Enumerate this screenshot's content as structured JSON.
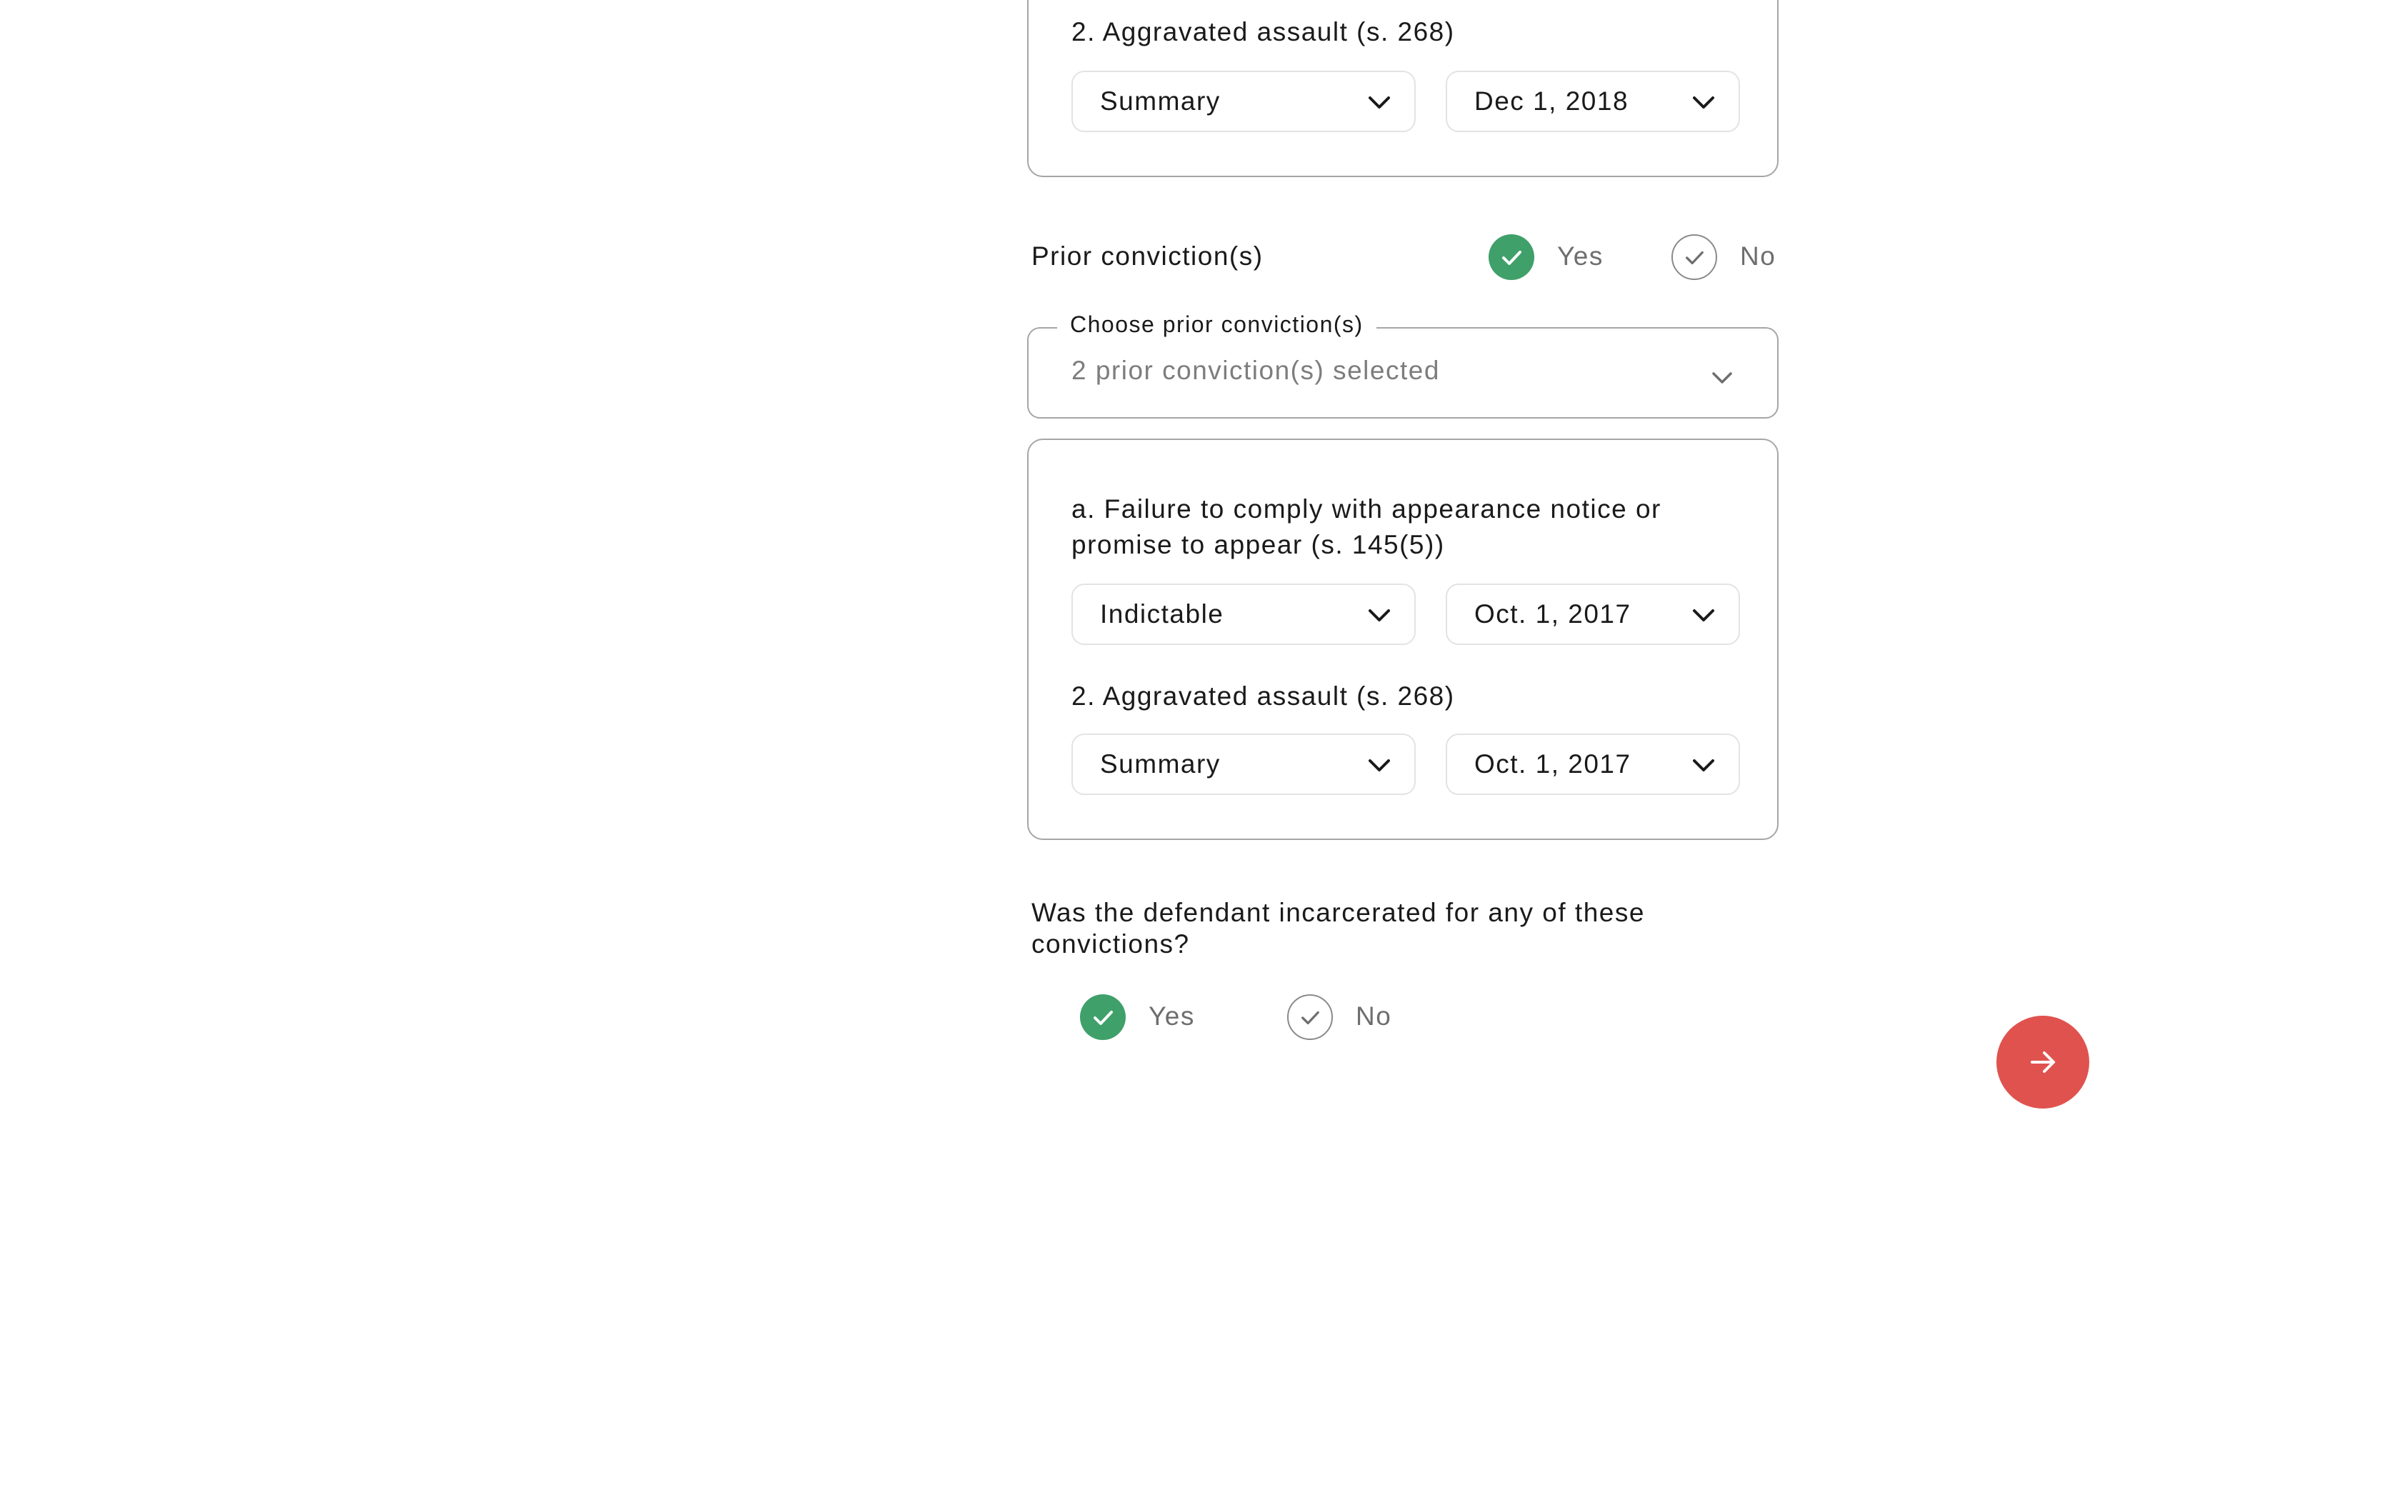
{
  "current_offence_card": {
    "offence_label": "2. Aggravated assault (s. 268)",
    "type_select": "Summary",
    "date_select": "Dec 1, 2018"
  },
  "prior_convictions": {
    "question": "Prior conviction(s)",
    "yes_label": "Yes",
    "no_label": "No",
    "selected": "Yes"
  },
  "prior_dropdown": {
    "legend": "Choose prior conviction(s)",
    "value": "2 prior conviction(s) selected"
  },
  "prior_list": [
    {
      "label": "a.  Failure to comply with appearance notice or promise to appear (s. 145(5))",
      "type_select": "Indictable",
      "date_select": "Oct. 1, 2017"
    },
    {
      "label": "2. Aggravated assault (s. 268)",
      "type_select": "Summary",
      "date_select": "Oct. 1, 2017"
    }
  ],
  "incarceration": {
    "question": "Was the defendant incarcerated for any of these convictions?",
    "yes_label": "Yes",
    "no_label": "No",
    "selected": "Yes"
  },
  "next_button": {
    "icon": "arrow-right-icon"
  },
  "colors": {
    "accent_green": "#3fa06a",
    "next_button_red": "#e0524e",
    "border": "#a6a6a6"
  }
}
